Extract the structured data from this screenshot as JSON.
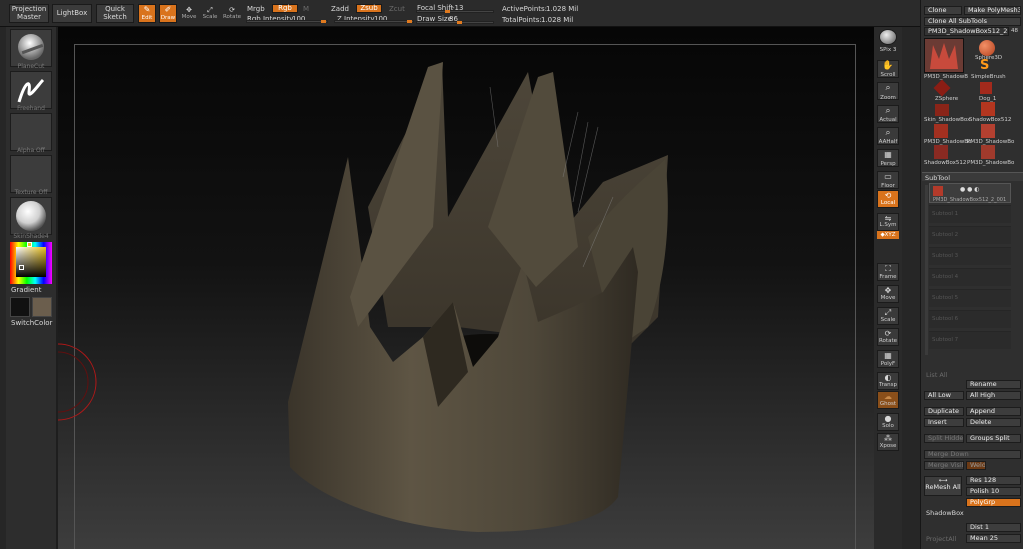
{
  "topbar": {
    "projection_master": "Projection\nMaster",
    "lightbox": "LightBox",
    "quick_sketch": "Quick\nSketch",
    "edit": "Edit",
    "draw": "Draw",
    "move": "Move",
    "scale": "Scale",
    "rotate": "Rotate",
    "mrgb": "Mrgb",
    "rgb": "Rgb",
    "m": "M",
    "rgb_intensity_label": "Rgb Intensity",
    "rgb_intensity_value": "100",
    "zadd": "Zadd",
    "zsub": "Zsub",
    "zcut": "Zcut",
    "z_intensity_label": "Z Intensity",
    "z_intensity_value": "100",
    "focal_shift_label": "Focal Shift",
    "focal_shift_value": "-13",
    "draw_size_label": "Draw Size",
    "draw_size_value": "86",
    "active_points_label": "ActivePoints:",
    "active_points_value": "1.028 Mil",
    "total_points_label": "TotalPoints:",
    "total_points_value": "1.028 Mil"
  },
  "leftshelf": {
    "brush_caption": "PlaneCut",
    "stroke_caption": "Freehand",
    "alpha_caption": "Alpha Off",
    "texture_caption": "Texture Off",
    "material_caption": "SkinShade4",
    "gradient": "Gradient",
    "switch_color": "SwitchColor",
    "colors": {
      "main": "#e8c020",
      "secondary": "#6b5e4d",
      "primary_swatch": "#111111"
    }
  },
  "righttools": {
    "spix": "SPix",
    "spix_value": "3",
    "scroll": "Scroll",
    "zoom": "Zoom",
    "actual": "Actual",
    "aahalf": "AAHalf",
    "persp": "Persp",
    "floor": "Floor",
    "local": "Local",
    "lsym": "L.Sym",
    "xyz": "◆XYZ",
    "frame": "Frame",
    "move": "Move",
    "scale": "Scale",
    "rotate": "Rotate",
    "polyf": "PolyF",
    "transp": "Transp",
    "ghost": "Ghost",
    "solo": "Solo",
    "xpose": "Xpose"
  },
  "rightpanel": {
    "clone": "Clone",
    "make_polymesh": "Make PolyMesh3D",
    "clone_all_subtools": "Clone All SubTools",
    "current_tool": "PM3D_ShadowBox512_2",
    "current_tool_count": "48",
    "tools": [
      {
        "name": "PM3D_ShadowB"
      },
      {
        "name": "Sphere3D"
      },
      {
        "name": "SimpleBrush"
      },
      {
        "name": "ZSphere"
      },
      {
        "name": "Dog_1"
      },
      {
        "name": "Skin_ShadowBox"
      },
      {
        "name": "ShadowBox512"
      },
      {
        "name": "PM3D_ShadowBo"
      },
      {
        "name": "PM3D_ShadowBo"
      },
      {
        "name": "ShadowBox512"
      },
      {
        "name": "PM3D_ShadowBo"
      }
    ],
    "subtool_header": "SubTool",
    "subtool_active": "PM3D_ShadowBox512_2_001",
    "subtool_slots": [
      "Subtool 1",
      "Subtool 2",
      "Subtool 3",
      "Subtool 4",
      "Subtool 5",
      "Subtool 6",
      "Subtool 7"
    ],
    "list_all": "List All",
    "rename": "Rename",
    "all_low": "All Low",
    "all_high": "All High",
    "duplicate": "Duplicate",
    "append": "Append",
    "insert": "Insert",
    "delete": "Delete",
    "split_hidden": "Split Hidden",
    "groups_split": "Groups Split",
    "merge_down": "Merge Down",
    "merge_visible": "Merge Visible",
    "weld": "Weld",
    "remesh_all": "ReMesh All",
    "res_label": "Res",
    "res_value": "128",
    "polish_label": "Polish",
    "polish_value": "10",
    "polygrp": "PolyGrp",
    "shadowbox": "ShadowBox",
    "dist_label": "Dist",
    "dist_value": "1",
    "mean_label": "Mean",
    "mean_value": "25",
    "projectall": "ProjectAll"
  }
}
